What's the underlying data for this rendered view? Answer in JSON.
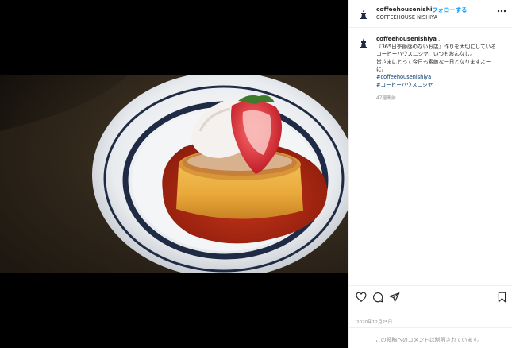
{
  "post": {
    "username": "coffeehousenishi",
    "separator": "•",
    "follow_label": "フォローする",
    "location": "COFFEEHOUSE NISHIYA",
    "more_icon": "more-horizontal-icon"
  },
  "caption": {
    "username": "coffeehousenishiya",
    "punct": " .",
    "lines": [
      "『365日季節感のないお店』作りを大切にしている",
      "コーヒーハウスニシヤ、いつもおんなじ。",
      "皆さまにとって今日も素敵な一日となりますよー",
      "に。"
    ],
    "hashtags": [
      "#coffeehousenishiya",
      "#コーヒーハウスニシヤ"
    ],
    "time_ago": "47週間前"
  },
  "actions": {
    "like_icon": "heart-icon",
    "comment_icon": "comment-icon",
    "share_icon": "paper-plane-icon",
    "save_icon": "bookmark-icon"
  },
  "date": "2020年12月25日",
  "comments_notice": "この投稿へのコメントは制限されています。",
  "colors": {
    "follow": "#0095f6",
    "hashtag": "#00376b",
    "muted": "#8e8e8e"
  }
}
